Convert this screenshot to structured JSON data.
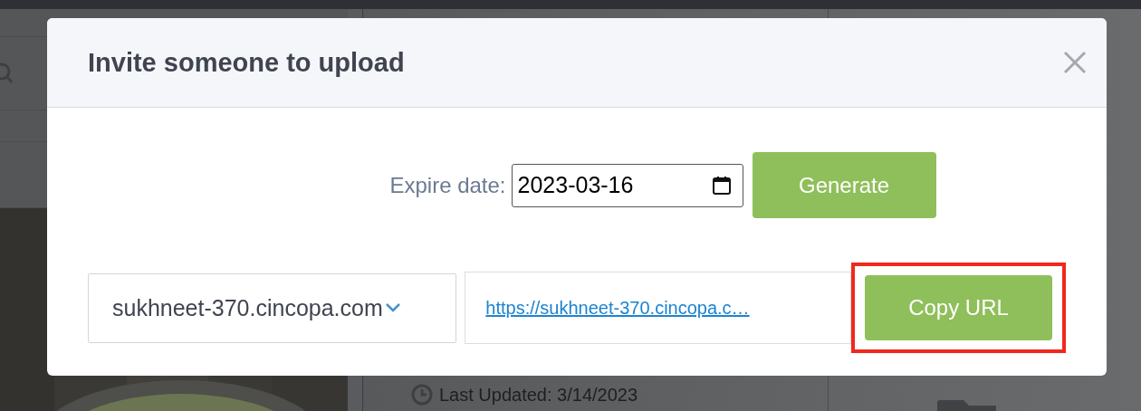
{
  "background": {
    "last_updated": "Last Updated: 3/14/2023"
  },
  "dialog": {
    "title": "Invite someone to upload",
    "expire_label": "Expire date:",
    "expire_date": "2023-03-16",
    "generate_button": "Generate",
    "domain_select": "sukhneet-370.cincopa.com",
    "upload_url": "https://sukhneet-370.cincopa.c…",
    "copy_button": "Copy URL",
    "copy_highlighted": true
  }
}
